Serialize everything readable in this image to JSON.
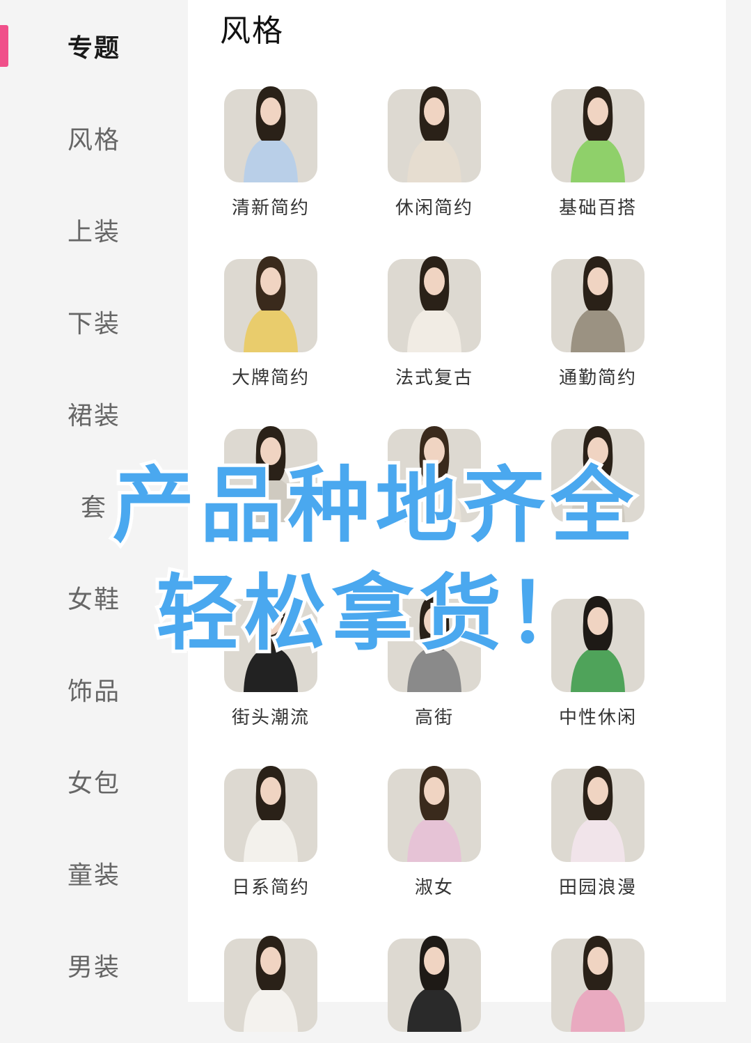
{
  "sidebar": {
    "items": [
      {
        "label": "专题",
        "active": true
      },
      {
        "label": "风格",
        "active": false
      },
      {
        "label": "上装",
        "active": false
      },
      {
        "label": "下装",
        "active": false
      },
      {
        "label": "裙装",
        "active": false
      },
      {
        "label": "套",
        "active": false
      },
      {
        "label": "女鞋",
        "active": false
      },
      {
        "label": "饰品",
        "active": false
      },
      {
        "label": "女包",
        "active": false
      },
      {
        "label": "童装",
        "active": false
      },
      {
        "label": "男装",
        "active": false
      }
    ],
    "accent": "#f0508a"
  },
  "content": {
    "title": "风格",
    "grid": [
      {
        "label": "清新简约",
        "top_color": "#b9cfe8",
        "hair": "#2a2118"
      },
      {
        "label": "休闲简约",
        "top_color": "#e6ddd0",
        "hair": "#2a2118"
      },
      {
        "label": "基础百搭",
        "top_color": "#8fd06a",
        "hair": "#2a2118"
      },
      {
        "label": "大牌简约",
        "top_color": "#e9cc6c",
        "hair": "#3a2a1c"
      },
      {
        "label": "法式复古",
        "top_color": "#f1ece4",
        "hair": "#2a2118"
      },
      {
        "label": "通勤简约",
        "top_color": "#9b9282",
        "hair": "#2a2118"
      },
      {
        "label": "",
        "top_color": "#cfcac0",
        "hair": "#2a2118"
      },
      {
        "label": "",
        "top_color": "#e8e2d8",
        "hair": "#3a2a1c"
      },
      {
        "label": "",
        "top_color": "#cfcac0",
        "hair": "#2a2118"
      },
      {
        "label": "街头潮流",
        "top_color": "#222222",
        "hair": "#2a2118"
      },
      {
        "label": "高街",
        "top_color": "#8a8a8a",
        "hair": "#2a2118"
      },
      {
        "label": "中性休闲",
        "top_color": "#4fa35a",
        "hair": "#1e1a16"
      },
      {
        "label": "日系简约",
        "top_color": "#f3f1ec",
        "hair": "#2a2118"
      },
      {
        "label": "淑女",
        "top_color": "#e6c3d6",
        "hair": "#3a2a1c"
      },
      {
        "label": "田园浪漫",
        "top_color": "#f1e4ea",
        "hair": "#2a2118"
      },
      {
        "label": "",
        "top_color": "#f4f2ee",
        "hair": "#2a2118"
      },
      {
        "label": "",
        "top_color": "#2a2a2a",
        "hair": "#1e1a16"
      },
      {
        "label": "",
        "top_color": "#e9aac0",
        "hair": "#2a2118"
      }
    ]
  },
  "overlay": {
    "line1": "产品种地齐全",
    "line2": "轻松拿货！",
    "color": "#4aa8ef"
  }
}
